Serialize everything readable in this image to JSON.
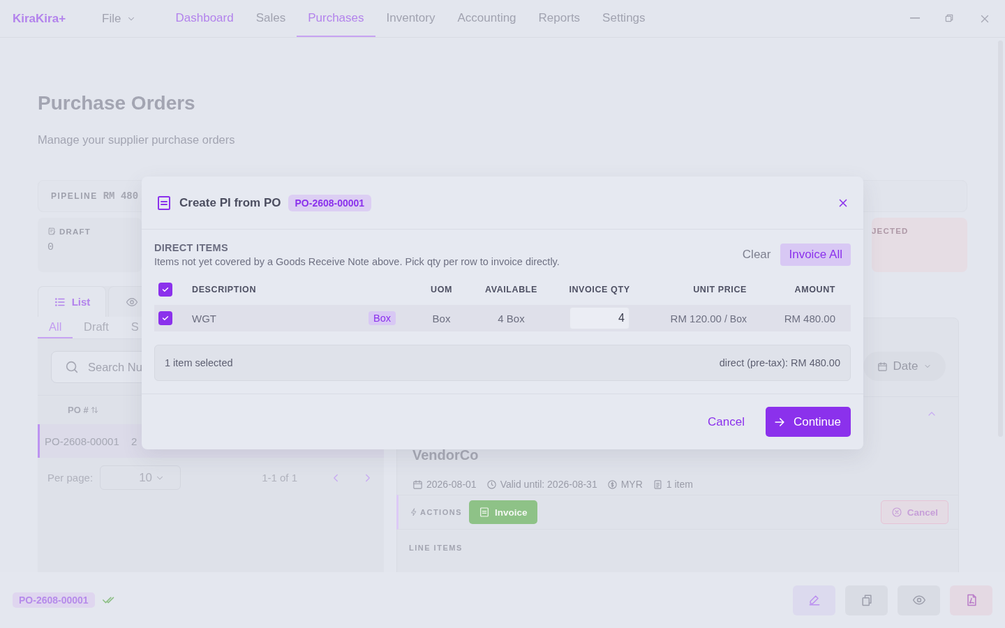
{
  "app": {
    "logo": "KiraKira+",
    "file_menu": "File",
    "nav": [
      {
        "label": "Dashboard",
        "selected": false,
        "kind": "accent"
      },
      {
        "label": "Sales",
        "selected": false
      },
      {
        "label": "Purchases",
        "selected": true
      },
      {
        "label": "Inventory",
        "selected": false
      },
      {
        "label": "Accounting",
        "selected": false
      },
      {
        "label": "Reports",
        "selected": false
      },
      {
        "label": "Settings",
        "selected": false
      }
    ]
  },
  "page": {
    "title": "Purchase Orders",
    "subtitle": "Manage your supplier purchase orders"
  },
  "pipeline": {
    "label": "PIPELINE",
    "value": "RM 480"
  },
  "status_cards": [
    {
      "kind": "draft",
      "label": "DRAFT",
      "count": "0"
    },
    {
      "kind": "rejected",
      "label": "JECTED"
    }
  ],
  "view_tabs": [
    {
      "kind": "list",
      "label": "List",
      "selected": true
    },
    {
      "kind": "preview",
      "selected": false
    }
  ],
  "filter_tabs": [
    {
      "label": "All",
      "selected": true
    },
    {
      "label": "Draft",
      "selected": false
    },
    {
      "label": "S",
      "selected": false
    }
  ],
  "search": {
    "placeholder": "Search Nu"
  },
  "table": {
    "columns": [
      "PO #"
    ],
    "rows": [
      {
        "cells": [
          "PO-2608-00001",
          "2"
        ],
        "selected": true
      }
    ]
  },
  "pagination": {
    "per_page_label": "Per page:",
    "per_page": "10",
    "range": "1-1 of 1"
  },
  "detail": {
    "date_filter": "Date",
    "vendor": "VendorCo",
    "meta": [
      {
        "kind": "date",
        "text": "2026-08-01"
      },
      {
        "kind": "clock",
        "text": "Valid until: 2026-08-31"
      },
      {
        "kind": "currency",
        "text": "MYR"
      },
      {
        "kind": "doc",
        "text": "1 item"
      }
    ],
    "actions_label": "ACTIONS",
    "actions": [
      {
        "kind": "invoice",
        "label": "Invoice"
      },
      {
        "kind": "cancel",
        "label": "Cancel"
      }
    ],
    "section": "LINE ITEMS"
  },
  "footer": {
    "badge": "PO-2608-00001",
    "buttons": [
      {
        "kind": "edit"
      },
      {
        "kind": "copy"
      },
      {
        "kind": "preview"
      },
      {
        "kind": "pdf"
      }
    ]
  },
  "modal": {
    "title": "Create PI from PO",
    "badge": "PO-2608-00001",
    "section_title": "DIRECT ITEMS",
    "description": "Items not yet covered by a Goods Receive Note above. Pick qty per row to invoice directly.",
    "clear": "Clear",
    "invoice_all": "Invoice All",
    "select_all": true,
    "columns": [
      "DESCRIPTION",
      "UOM",
      "AVAILABLE",
      "INVOICE QTY",
      "UNIT PRICE",
      "AMOUNT"
    ],
    "rows": [
      {
        "checked": true,
        "description": "WGT",
        "tag": "Box",
        "uom": "Box",
        "available": "4 Box",
        "qty": "4",
        "unit_price": "RM 120.00",
        "per_unit": "/ Box",
        "amount": "RM 480.00"
      }
    ],
    "summary": "1 item selected",
    "total": "direct (pre-tax): RM 480.00",
    "cancel": "Cancel",
    "continue": "Continue"
  }
}
